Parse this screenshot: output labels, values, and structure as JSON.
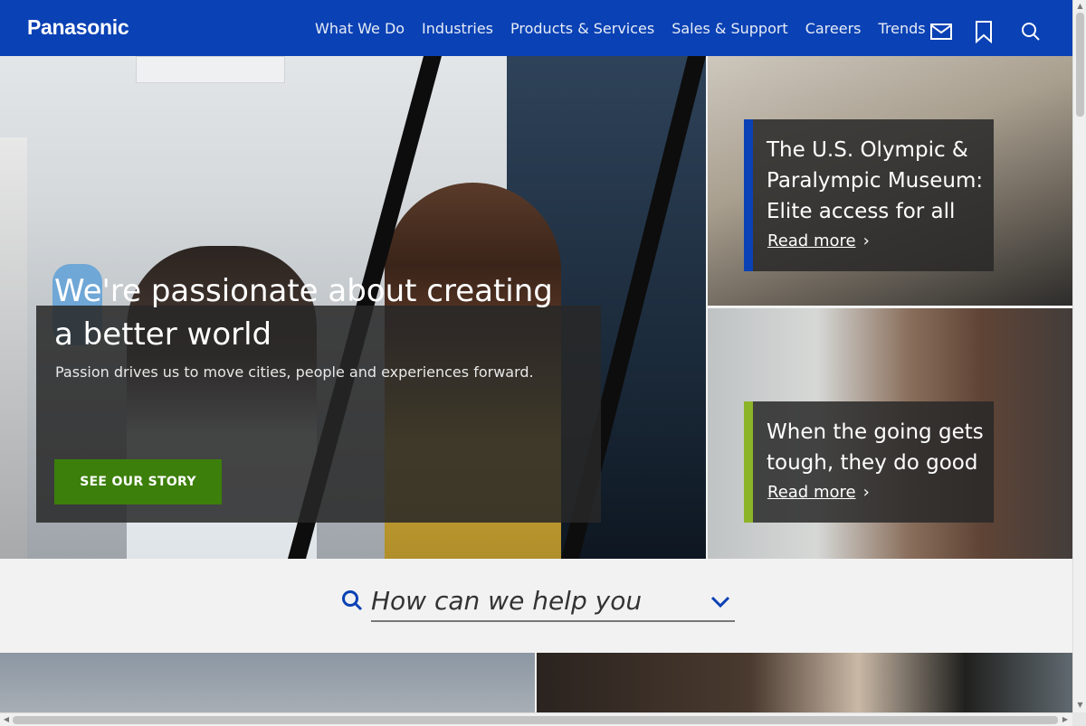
{
  "header": {
    "logo": "Panasonic",
    "nav": [
      "What We Do",
      "Industries",
      "Products & Services",
      "Sales & Support",
      "Careers",
      "Trends"
    ],
    "icons": [
      "mail-icon",
      "bookmark-icon",
      "search-icon"
    ],
    "background_color": "#0a41b4"
  },
  "hero": {
    "title": "We're passionate about creating a better world",
    "subtitle": "Passion drives us to move cities, people and experiences forward.",
    "button_label": "SEE OUR STORY",
    "button_color": "#3c7f0b"
  },
  "cards": [
    {
      "title": "The U.S. Olympic & Paralympic Museum: Elite access for all",
      "link_label": "Read more",
      "accent_color": "#0a41b4"
    },
    {
      "title": "When the going gets tough, they do good",
      "link_label": "Read more",
      "accent_color": "#8cb428"
    }
  ],
  "help": {
    "placeholder": "How can we help you",
    "icon": "search-icon",
    "dropdown_icon": "chevron-down-icon",
    "accent_color": "#0a41b4"
  }
}
